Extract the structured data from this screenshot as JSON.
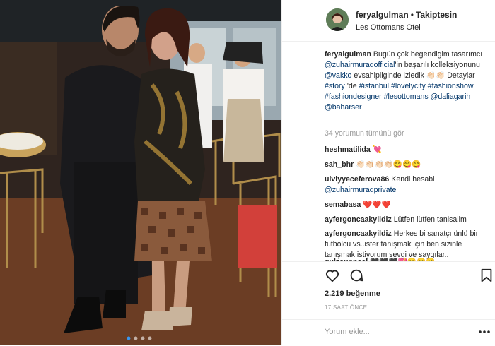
{
  "post": {
    "username": "feryalgulman",
    "follow_status": "Takiptesin",
    "location": "Les Ottomans Otel",
    "caption": {
      "text_1": "Bugün çok begendigim tasarımcı",
      "mention_1": "@zuhairmuradofficial",
      "text_2": "'in başarılı kolleksiyonunu",
      "mention_2": "@vakko",
      "text_3": "evsahipliginde izledik",
      "emojis": "👏🏻👏🏻",
      "text_4": "Detaylar",
      "tag_story": "#story",
      "text_5": "'de",
      "tags": [
        "#istanbul",
        "#lovelycity",
        "#fashionshow",
        "#fashiondesigner",
        "#lesottomans"
      ],
      "mentions_end": [
        "@daliagarih",
        "@baharser"
      ]
    },
    "view_all": "34 yorumun tümünü gör",
    "comments": [
      {
        "user": "heshmatilida",
        "text": "💘"
      },
      {
        "user": "sah_bhr",
        "text": "👏🏻👏🏻👏🏻👏🏻😋😋😋"
      },
      {
        "user": "ulviyyeceferova86",
        "text": "Kendi hesabi",
        "mention": "@zuhairmuradprivate"
      },
      {
        "user": "semabasa",
        "text": "❤️❤️❤️"
      },
      {
        "user": "ayfergoncaakyildiz",
        "text": "Lütfen lütfen tanisalim"
      },
      {
        "user": "ayfergoncaakyildiz",
        "text": "Herkes bi sanatçı ünlü bir futbolcu vs..ister tanışmak için ben sizinle tanışmak istiyorum sevgi ve saygılar.."
      },
      {
        "user": "gulzaunnael",
        "text": "🖤🖤🖤💖😊😊😊"
      }
    ],
    "likes": "2.219 beğenme",
    "time_ago": "17 SAAT ÖNCE",
    "comment_placeholder": "Yorum ekle..."
  },
  "icons": {
    "like": "heart-icon",
    "comment": "comment-bubble-icon",
    "save": "bookmark-icon",
    "options": "more-dots-icon"
  },
  "colors": {
    "link": "#003569",
    "muted": "#999999",
    "border": "#efefef",
    "text": "#262626"
  },
  "carousel": {
    "count": 4,
    "active": 0
  }
}
